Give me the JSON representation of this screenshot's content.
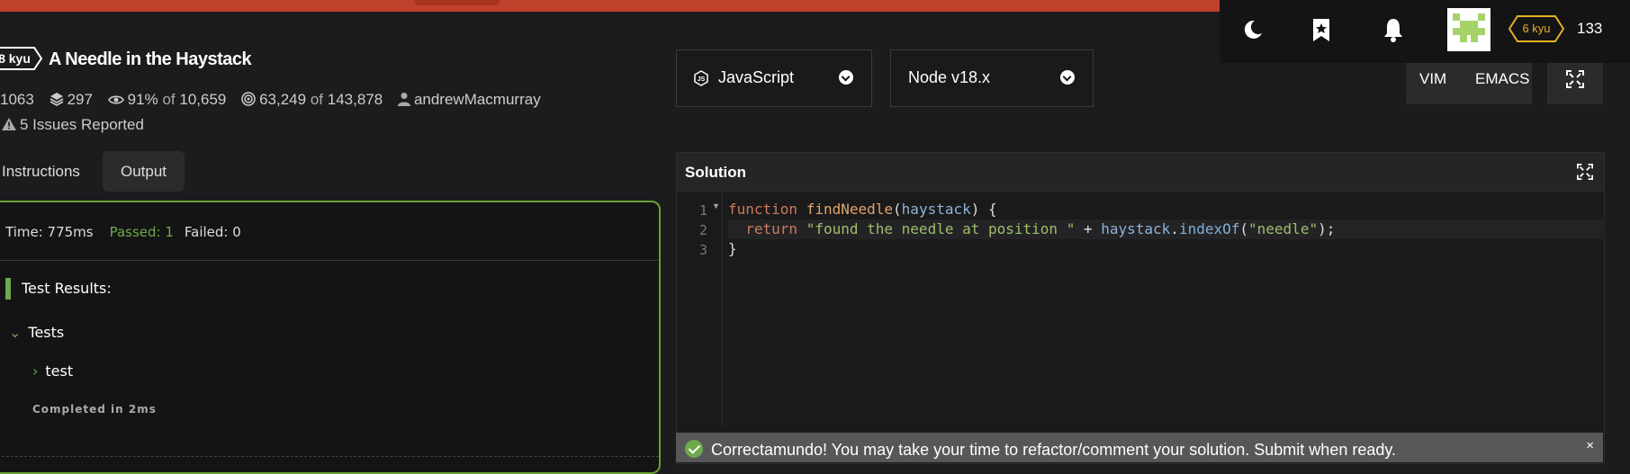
{
  "kata": {
    "rank": "8 kyu",
    "title": "A Needle in the Haystack",
    "stats": {
      "votes": "1063",
      "collections": "297",
      "satisfaction_pct": "91%",
      "of_label_1": "of",
      "satisfaction_votes": "10,659",
      "completed": "63,249",
      "of_label_2": "of",
      "attempted": "143,878",
      "author": "andrewMacmurray"
    },
    "issues": "5 Issues Reported"
  },
  "tabs": [
    {
      "label": "Instructions",
      "active": false
    },
    {
      "label": "Output",
      "active": true
    }
  ],
  "output": {
    "time": "Time: 775ms",
    "passed": "Passed: 1",
    "failed": "Failed: 0",
    "test_results_label": "Test Results:",
    "tests_label": "Tests",
    "test_label": "test",
    "completed": "Completed in 2ms"
  },
  "language": {
    "label": "JavaScript"
  },
  "version": {
    "label": "Node v18.x"
  },
  "modes": {
    "vim": "VIM",
    "emacs": "EMACS"
  },
  "editor": {
    "title": "Solution",
    "lines": [
      "1",
      "2",
      "3"
    ],
    "code": {
      "line1_kw": "function",
      "line1_fn": "findNeedle",
      "line1_open": "(",
      "line1_param": "haystack",
      "line1_close": ") {",
      "line2_indent": "  ",
      "line2_kw": "return",
      "line2_str": "\"found the needle at position \"",
      "line2_plus": " + ",
      "line2_obj": "haystack",
      "line2_dot": ".",
      "line2_method": "indexOf",
      "line2_open": "(",
      "line2_arg": "\"needle\"",
      "line2_close": ");",
      "line3": "}"
    }
  },
  "toast": {
    "message": "Correctamundo! You may take your time to refactor/comment your solution. Submit when ready.",
    "close": "×"
  },
  "user": {
    "rank": "6 kyu",
    "honor": "133"
  },
  "colors": {
    "accent_green": "#6ea94b",
    "top_bar": "#c0412c",
    "kyu_yellow": "#e6b026"
  },
  "icons": [
    "moon-icon",
    "bookmark-star-icon",
    "bell-icon",
    "avatar",
    "fullscreen-icon",
    "check-circle-icon"
  ]
}
